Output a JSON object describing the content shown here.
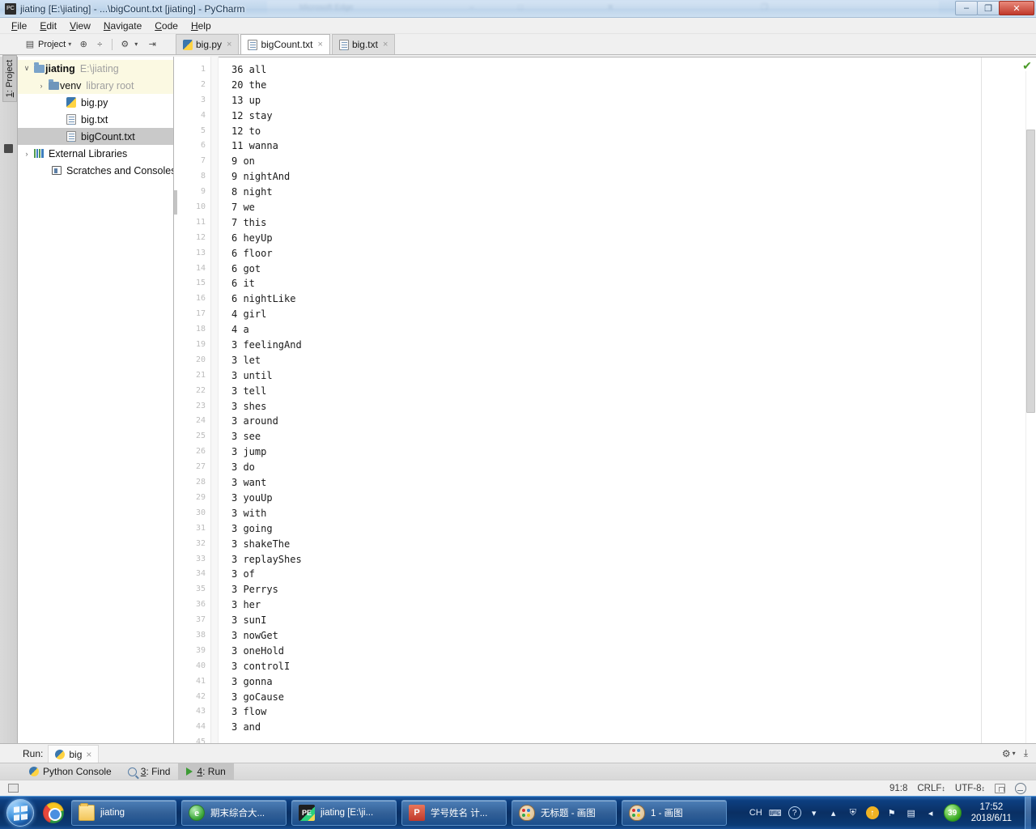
{
  "window": {
    "title": "jiating [E:\\jiating] - ...\\bigCount.txt [jiating] - PyCharm",
    "app_icon": "PC",
    "minimize": "–",
    "maximize": "❐",
    "close": "✕",
    "ghost_titles": [
      "Microsoft Edge",
      "–",
      "□",
      "✕",
      "❐"
    ]
  },
  "menubar": {
    "items": [
      {
        "label": "File",
        "mnemonic": "F"
      },
      {
        "label": "Edit",
        "mnemonic": "E"
      },
      {
        "label": "View",
        "mnemonic": "V"
      },
      {
        "label": "Navigate",
        "mnemonic": "N"
      },
      {
        "label": "Code",
        "mnemonic": "C"
      },
      {
        "label": "Help",
        "mnemonic": "H"
      }
    ]
  },
  "toolbar": {
    "project_label": "Project",
    "project_caret": "▾",
    "icons": [
      {
        "name": "target-icon",
        "glyph": "⊕"
      },
      {
        "name": "collapse-all-icon",
        "glyph": "÷"
      },
      {
        "name": "settings-icon",
        "glyph": "⚙"
      },
      {
        "name": "settings-caret",
        "glyph": "▾"
      },
      {
        "name": "hide-icon",
        "glyph": "⇥"
      }
    ]
  },
  "vertical_tab": {
    "label": "1: Project",
    "mnemonic": "1"
  },
  "editor_tabs": [
    {
      "label": "big.py",
      "icon": "python-file-icon",
      "active": false,
      "close": "×"
    },
    {
      "label": "bigCount.txt",
      "icon": "text-file-icon",
      "active": true,
      "close": "×"
    },
    {
      "label": "big.txt",
      "icon": "text-file-icon",
      "active": false,
      "close": "×"
    }
  ],
  "project_tree": [
    {
      "indent": 0,
      "arrow": "∨",
      "icon": "folder-icon",
      "label": "jiating",
      "suffix": "E:\\jiating",
      "bold": true,
      "highlight": "yellow"
    },
    {
      "indent": 1,
      "arrow": "›",
      "icon": "folder-icon",
      "label": "venv",
      "suffix": "library root",
      "bold": false,
      "highlight": "yellow"
    },
    {
      "indent": 2,
      "arrow": "",
      "icon": "python-file-icon",
      "label": "big.py",
      "suffix": "",
      "bold": false,
      "highlight": "none"
    },
    {
      "indent": 2,
      "arrow": "",
      "icon": "text-file-icon",
      "label": "big.txt",
      "suffix": "",
      "bold": false,
      "highlight": "none"
    },
    {
      "indent": 2,
      "arrow": "",
      "icon": "text-file-icon",
      "label": "bigCount.txt",
      "suffix": "",
      "bold": false,
      "highlight": "gray"
    },
    {
      "indent": 0,
      "arrow": "›",
      "icon": "library-icon",
      "label": "External Libraries",
      "suffix": "",
      "bold": false,
      "highlight": "none"
    },
    {
      "indent": 1,
      "arrow": "",
      "icon": "scratches-icon",
      "label": "Scratches and Consoles",
      "suffix": "",
      "bold": false,
      "highlight": "none"
    }
  ],
  "editor": {
    "file": "bigCount.txt",
    "inspection_icon": "✔",
    "lines": [
      "36 all",
      "20 the",
      "13 up",
      "12 stay",
      "12 to",
      "11 wanna",
      "9 on",
      "9 nightAnd",
      "8 night",
      "7 we",
      "7 this",
      "6 heyUp",
      "6 floor",
      "6 got",
      "6 it",
      "6 nightLike",
      "4 girl",
      "4 a",
      "3 feelingAnd",
      "3 let",
      "3 until",
      "3 tell",
      "3 shes",
      "3 around",
      "3 see",
      "3 jump",
      "3 do",
      "3 want",
      "3 youUp",
      "3 with",
      "3 going",
      "3 shakeThe",
      "3 replayShes",
      "3 of",
      "3 Perrys",
      "3 her",
      "3 sunI",
      "3 nowGet",
      "3 oneHold",
      "3 controlI",
      "3 gonna",
      "3 goCause",
      "3 flow",
      "3 and"
    ]
  },
  "run_pane": {
    "label": "Run:",
    "tab_label": "big",
    "tab_icon": "python-icon",
    "tab_close": "×",
    "settings_icon": "⚙",
    "settings_caret": "▾",
    "hide_icon": "⤓"
  },
  "bottom_tabs": [
    {
      "label": "Python Console",
      "icon": "python-icon",
      "mnemonic": "",
      "active": false
    },
    {
      "label": "3: Find",
      "icon": "find-icon",
      "mnemonic": "3",
      "active": false
    },
    {
      "label": "4: Run",
      "icon": "run-icon",
      "mnemonic": "4",
      "active": true
    }
  ],
  "statusbar": {
    "caret_position": "91:8",
    "line_separator": "CRLF",
    "line_separator_caret": "↕",
    "encoding": "UTF-8",
    "encoding_caret": "↕",
    "lock_icon": "lock-icon",
    "face_icon": "face-icon"
  },
  "taskbar": {
    "start_label": "Start",
    "quick_launch": [
      {
        "name": "chrome-icon",
        "label": "Google Chrome"
      }
    ],
    "buttons": [
      {
        "label": "jiating",
        "icon": "folder-icon"
      },
      {
        "label": "期末综合大...",
        "icon": "ie-icon"
      },
      {
        "label": "jiating [E:\\ji...",
        "icon": "pycharm-icon"
      },
      {
        "label": "学号姓名 计...",
        "icon": "powerpoint-icon"
      },
      {
        "label": "无标题 - 画图",
        "icon": "paint-icon"
      },
      {
        "label": "1 - 画图",
        "icon": "paint-icon"
      }
    ],
    "tray": {
      "ime": "CH",
      "icons": [
        {
          "name": "keyboard-icon",
          "glyph": "⌨"
        },
        {
          "name": "help-icon",
          "glyph": "?"
        },
        {
          "name": "overflow-icon",
          "glyph": "▾"
        },
        {
          "name": "show-hidden-icon",
          "glyph": "▴"
        },
        {
          "name": "shield-icon",
          "glyph": "⛨"
        },
        {
          "name": "update-icon",
          "glyph": "↑"
        },
        {
          "name": "flag-icon",
          "glyph": "⚑"
        },
        {
          "name": "network-icon",
          "glyph": "▤"
        },
        {
          "name": "volume-icon",
          "glyph": "◂"
        }
      ],
      "badge": "39",
      "time": "17:52",
      "date": "2018/6/11"
    }
  },
  "colors": {
    "accent": "#3b77ad",
    "selection": "#c9c9c9",
    "highlight": "#fbf9e2",
    "taskbar": "#0a2f63",
    "ok_green": "#4a9a28"
  }
}
